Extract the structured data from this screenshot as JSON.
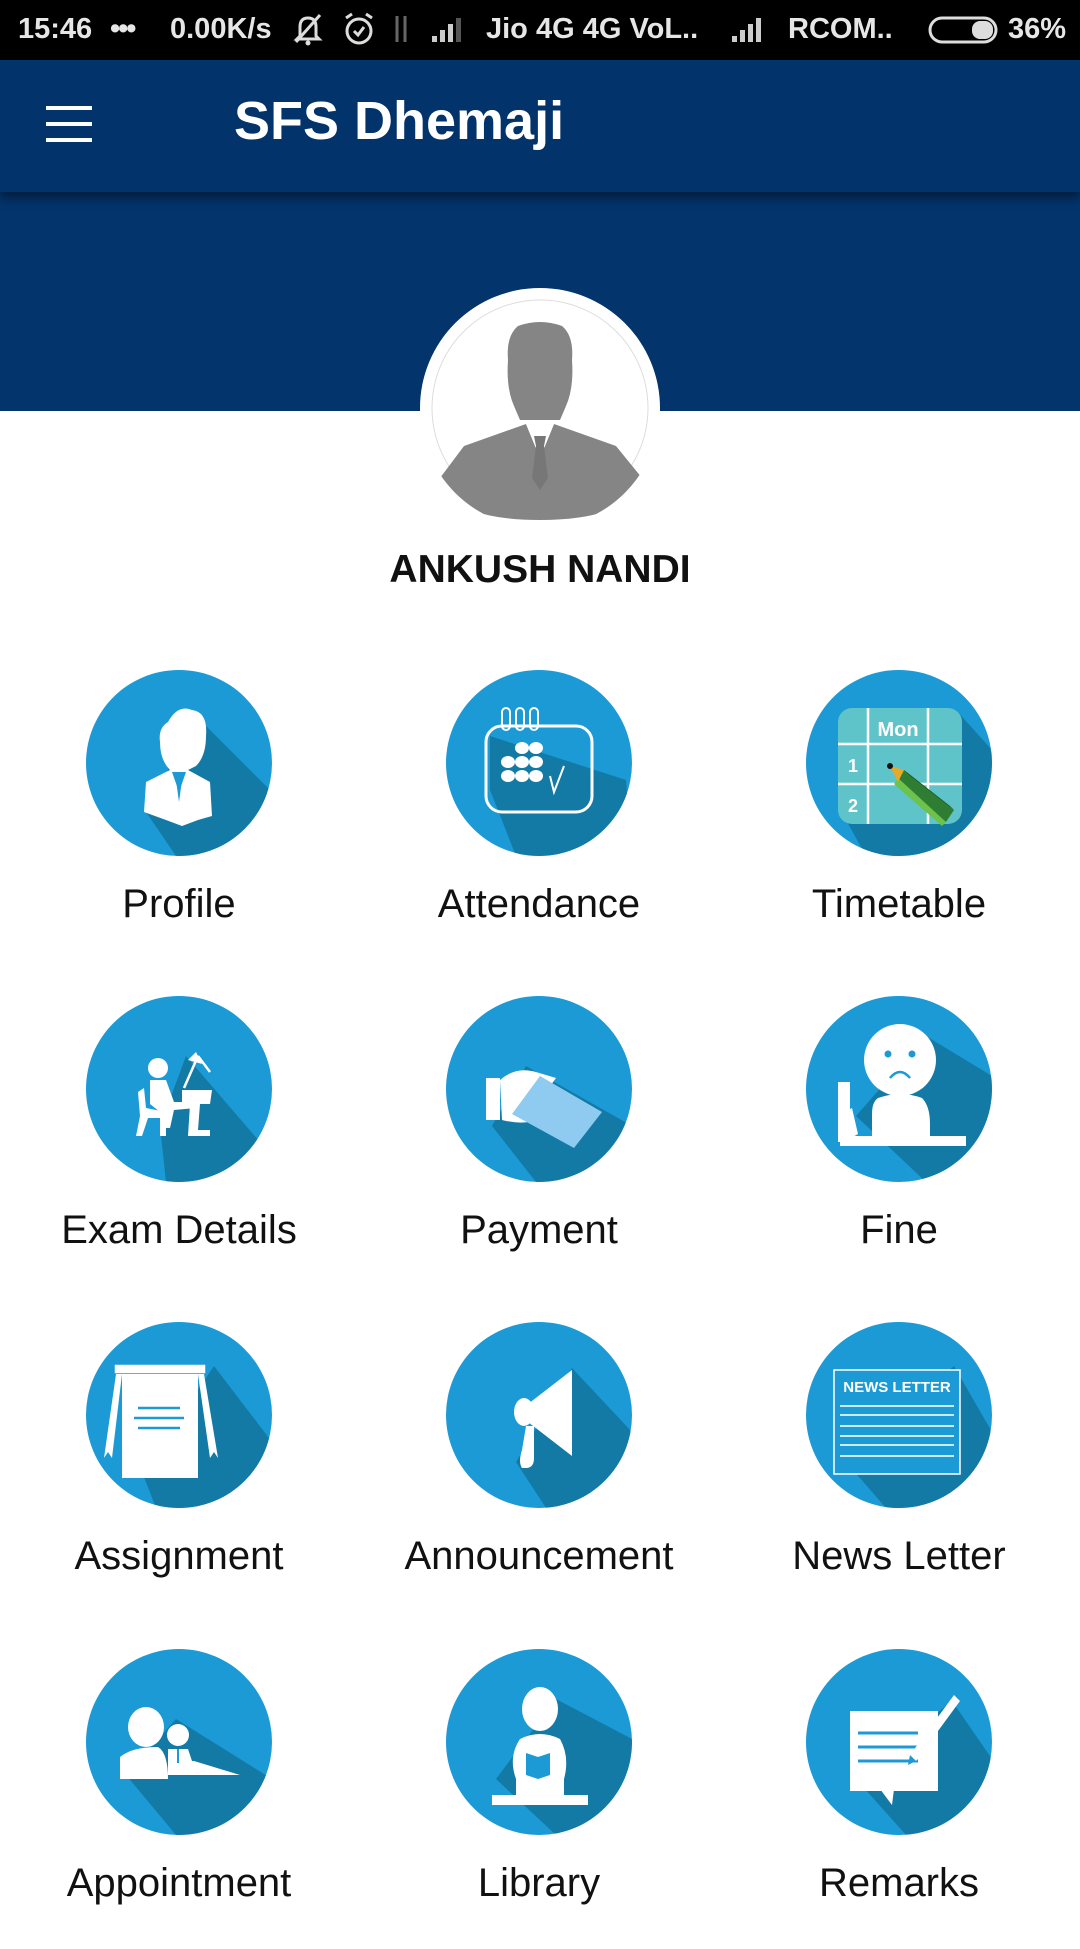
{
  "status_bar": {
    "time": "15:46",
    "more": "•••",
    "net_speed": "0.00K/s",
    "carrier1": "Jio 4G 4G VoL..",
    "carrier2": "RCOM..",
    "battery": "36%",
    "battery_level_percent": 36
  },
  "app_bar": {
    "title": "SFS Dhemaji",
    "menu_icon": "hamburger-menu-icon"
  },
  "profile": {
    "name": "ANKUSH NANDI",
    "avatar_icon": "user-silhouette-icon"
  },
  "colors": {
    "app_bar": "#02336a",
    "icon_circle": "#1b9ad6",
    "icon_shadow": "#137aa6"
  },
  "menu": [
    {
      "label": "Profile",
      "icon": "profile-icon"
    },
    {
      "label": "Attendance",
      "icon": "attendance-calendar-icon"
    },
    {
      "label": "Timetable",
      "icon": "timetable-icon",
      "icon_text": {
        "day": "Mon",
        "row1": "1",
        "row2": "2"
      }
    },
    {
      "label": "Exam Details",
      "icon": "exam-student-desk-icon"
    },
    {
      "label": "Payment",
      "icon": "payment-hand-card-icon"
    },
    {
      "label": "Fine",
      "icon": "fine-sad-face-icon"
    },
    {
      "label": "Assignment",
      "icon": "assignment-notepad-icon"
    },
    {
      "label": "Announcement",
      "icon": "megaphone-icon"
    },
    {
      "label": "News Letter",
      "icon": "newsletter-icon",
      "icon_text": "NEWS LETTER"
    },
    {
      "label": "Appointment",
      "icon": "appointment-people-icon"
    },
    {
      "label": "Library",
      "icon": "library-reader-icon"
    },
    {
      "label": "Remarks",
      "icon": "remarks-note-icon"
    }
  ]
}
